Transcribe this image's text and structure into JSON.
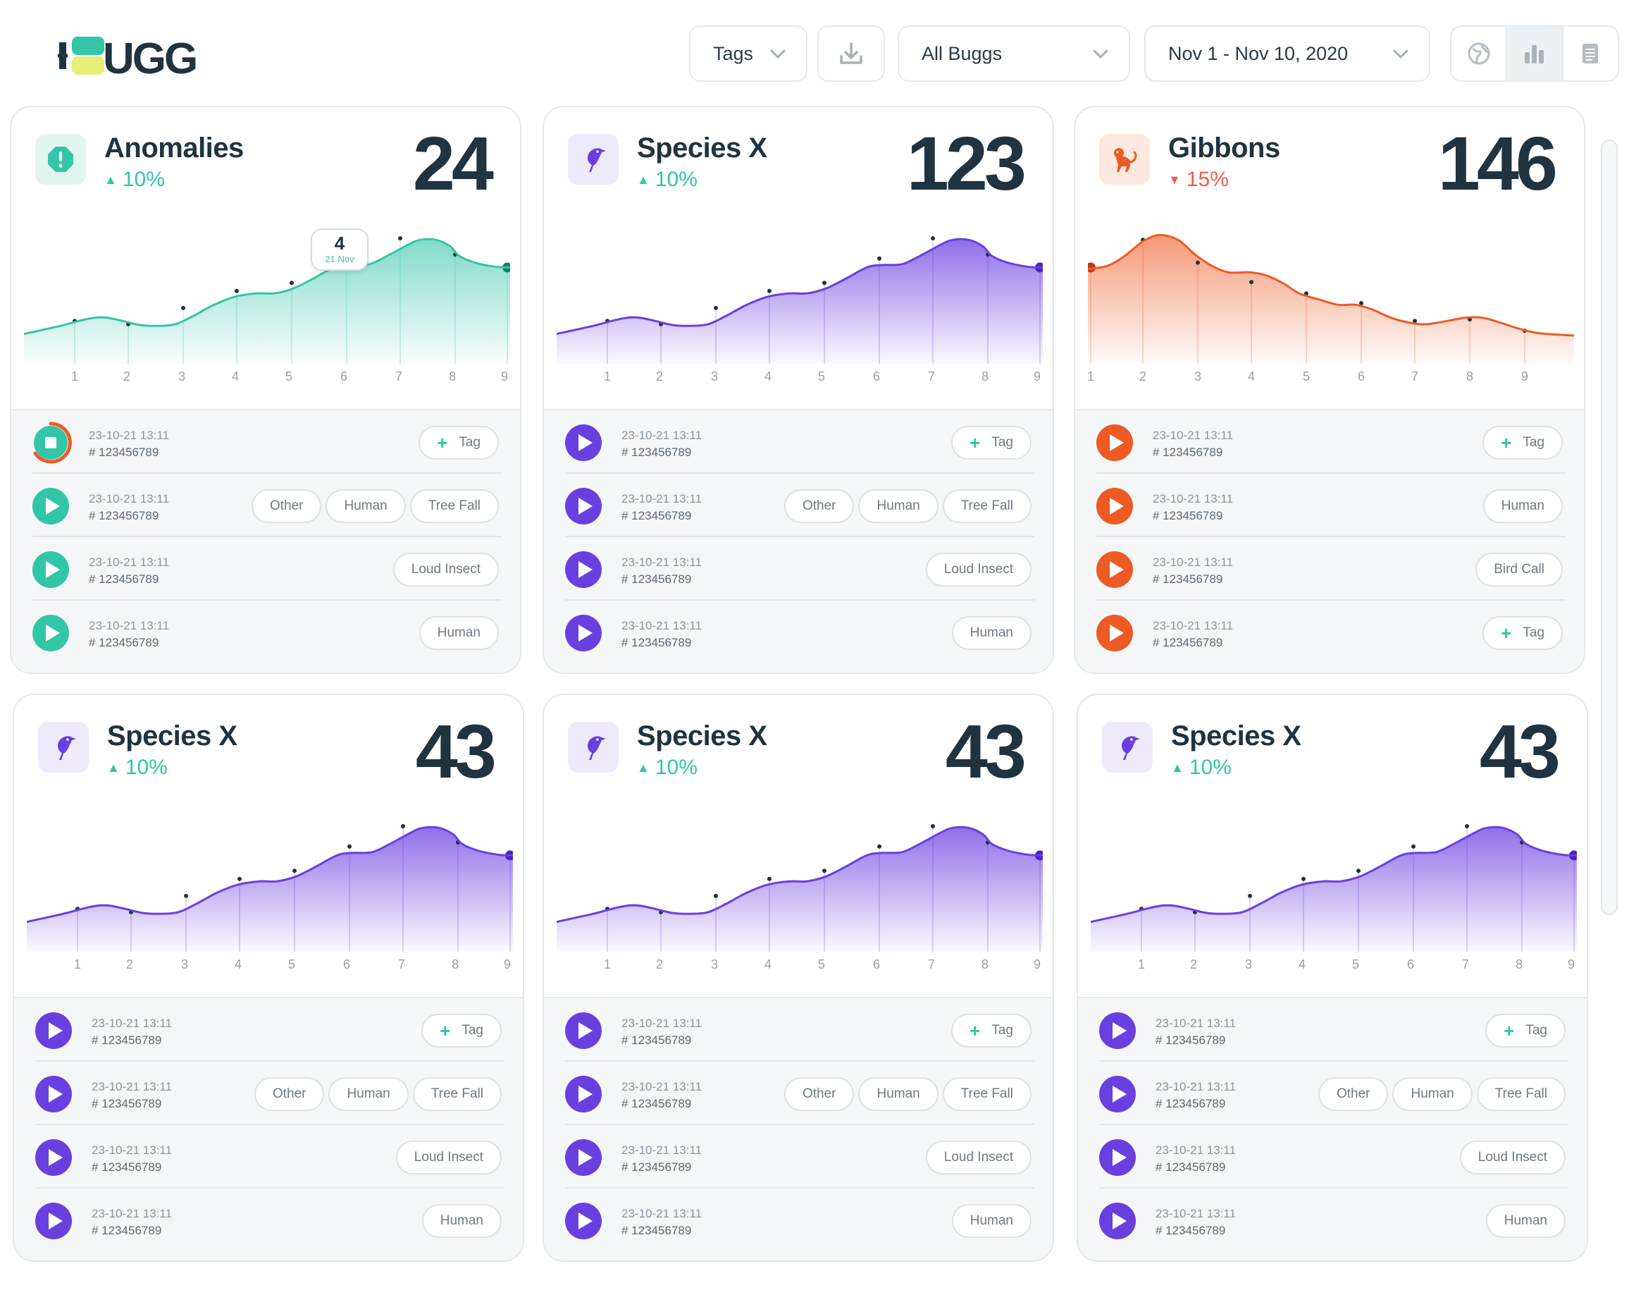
{
  "brand": {
    "logo_text": "UGG"
  },
  "toolbar": {
    "tags_label": "Tags",
    "bugg_filter": "All Buggs",
    "date_range": "Nov 1 - Nov 10, 2020"
  },
  "colors": {
    "teal": "#33c5a7",
    "purple": "#6a3fe0",
    "orange": "#ee5a24",
    "red_trend": "#f05a4f",
    "text": "#1f3340"
  },
  "cards": [
    {
      "title": "Anomalies",
      "icon": "alert-icon",
      "trend": "10%",
      "trend_dir": "up",
      "total": "24",
      "theme": "teal",
      "tooltip": {
        "value": "4",
        "date": "21 Nov"
      },
      "x_ticks": [
        "1",
        "2",
        "3",
        "4",
        "5",
        "6",
        "7",
        "8",
        "9"
      ],
      "rows": [
        {
          "time": "23-10-21 13:11",
          "id": "# 123456789",
          "tags": [
            "Tag"
          ],
          "recording": true
        },
        {
          "time": "23-10-21 13:11",
          "id": "# 123456789",
          "tags": [
            "Other",
            "Human",
            "Tree Fall"
          ]
        },
        {
          "time": "23-10-21 13:11",
          "id": "# 123456789",
          "tags": [
            "Loud Insect"
          ]
        },
        {
          "time": "23-10-21 13:11",
          "id": "# 123456789",
          "tags": [
            "Human"
          ]
        }
      ]
    },
    {
      "title": "Species X",
      "icon": "bird-icon",
      "trend": "10%",
      "trend_dir": "up",
      "total": "123",
      "theme": "purple",
      "x_ticks": [
        "1",
        "2",
        "3",
        "4",
        "5",
        "6",
        "7",
        "8",
        "9"
      ],
      "rows": [
        {
          "time": "23-10-21 13:11",
          "id": "# 123456789",
          "tags": [
            "Tag"
          ]
        },
        {
          "time": "23-10-21 13:11",
          "id": "# 123456789",
          "tags": [
            "Other",
            "Human",
            "Tree Fall"
          ]
        },
        {
          "time": "23-10-21 13:11",
          "id": "# 123456789",
          "tags": [
            "Loud Insect"
          ]
        },
        {
          "time": "23-10-21 13:11",
          "id": "# 123456789",
          "tags": [
            "Human"
          ]
        }
      ]
    },
    {
      "title": "Gibbons",
      "icon": "monkey-icon",
      "trend": "15%",
      "trend_dir": "down",
      "total": "146",
      "theme": "orange",
      "x_ticks": [
        "1",
        "2",
        "3",
        "4",
        "5",
        "6",
        "7",
        "8",
        "9"
      ],
      "rows": [
        {
          "time": "23-10-21 13:11",
          "id": "# 123456789",
          "tags": [
            "Tag"
          ]
        },
        {
          "time": "23-10-21 13:11",
          "id": "# 123456789",
          "tags": [
            "Human"
          ]
        },
        {
          "time": "23-10-21 13:11",
          "id": "# 123456789",
          "tags": [
            "Bird Call"
          ]
        },
        {
          "time": "23-10-21 13:11",
          "id": "# 123456789",
          "tags": [
            "Tag"
          ]
        }
      ]
    },
    {
      "title": "Species X",
      "icon": "bird-icon",
      "trend": "10%",
      "trend_dir": "up",
      "total": "43",
      "theme": "purple",
      "x_ticks": [
        "1",
        "2",
        "3",
        "4",
        "5",
        "6",
        "7",
        "8",
        "9"
      ],
      "rows": [
        {
          "time": "23-10-21 13:11",
          "id": "# 123456789",
          "tags": [
            "Tag"
          ]
        },
        {
          "time": "23-10-21 13:11",
          "id": "# 123456789",
          "tags": [
            "Other",
            "Human",
            "Tree Fall"
          ]
        },
        {
          "time": "23-10-21 13:11",
          "id": "# 123456789",
          "tags": [
            "Loud Insect"
          ]
        },
        {
          "time": "23-10-21 13:11",
          "id": "# 123456789",
          "tags": [
            "Human"
          ]
        }
      ]
    },
    {
      "title": "Species X",
      "icon": "bird-icon",
      "trend": "10%",
      "trend_dir": "up",
      "total": "43",
      "theme": "purple",
      "x_ticks": [
        "1",
        "2",
        "3",
        "4",
        "5",
        "6",
        "7",
        "8",
        "9"
      ],
      "rows": [
        {
          "time": "23-10-21 13:11",
          "id": "# 123456789",
          "tags": [
            "Tag"
          ]
        },
        {
          "time": "23-10-21 13:11",
          "id": "# 123456789",
          "tags": [
            "Other",
            "Human",
            "Tree Fall"
          ]
        },
        {
          "time": "23-10-21 13:11",
          "id": "# 123456789",
          "tags": [
            "Loud Insect"
          ]
        },
        {
          "time": "23-10-21 13:11",
          "id": "# 123456789",
          "tags": [
            "Human"
          ]
        }
      ]
    },
    {
      "title": "Species X",
      "icon": "bird-icon",
      "trend": "10%",
      "trend_dir": "up",
      "total": "43",
      "theme": "purple",
      "x_ticks": [
        "1",
        "2",
        "3",
        "4",
        "5",
        "6",
        "7",
        "8",
        "9"
      ],
      "rows": [
        {
          "time": "23-10-21 13:11",
          "id": "# 123456789",
          "tags": [
            "Tag"
          ]
        },
        {
          "time": "23-10-21 13:11",
          "id": "# 123456789",
          "tags": [
            "Other",
            "Human",
            "Tree Fall"
          ]
        },
        {
          "time": "23-10-21 13:11",
          "id": "# 123456789",
          "tags": [
            "Loud Insect"
          ]
        },
        {
          "time": "23-10-21 13:11",
          "id": "# 123456789",
          "tags": [
            "Human"
          ]
        }
      ]
    }
  ]
}
